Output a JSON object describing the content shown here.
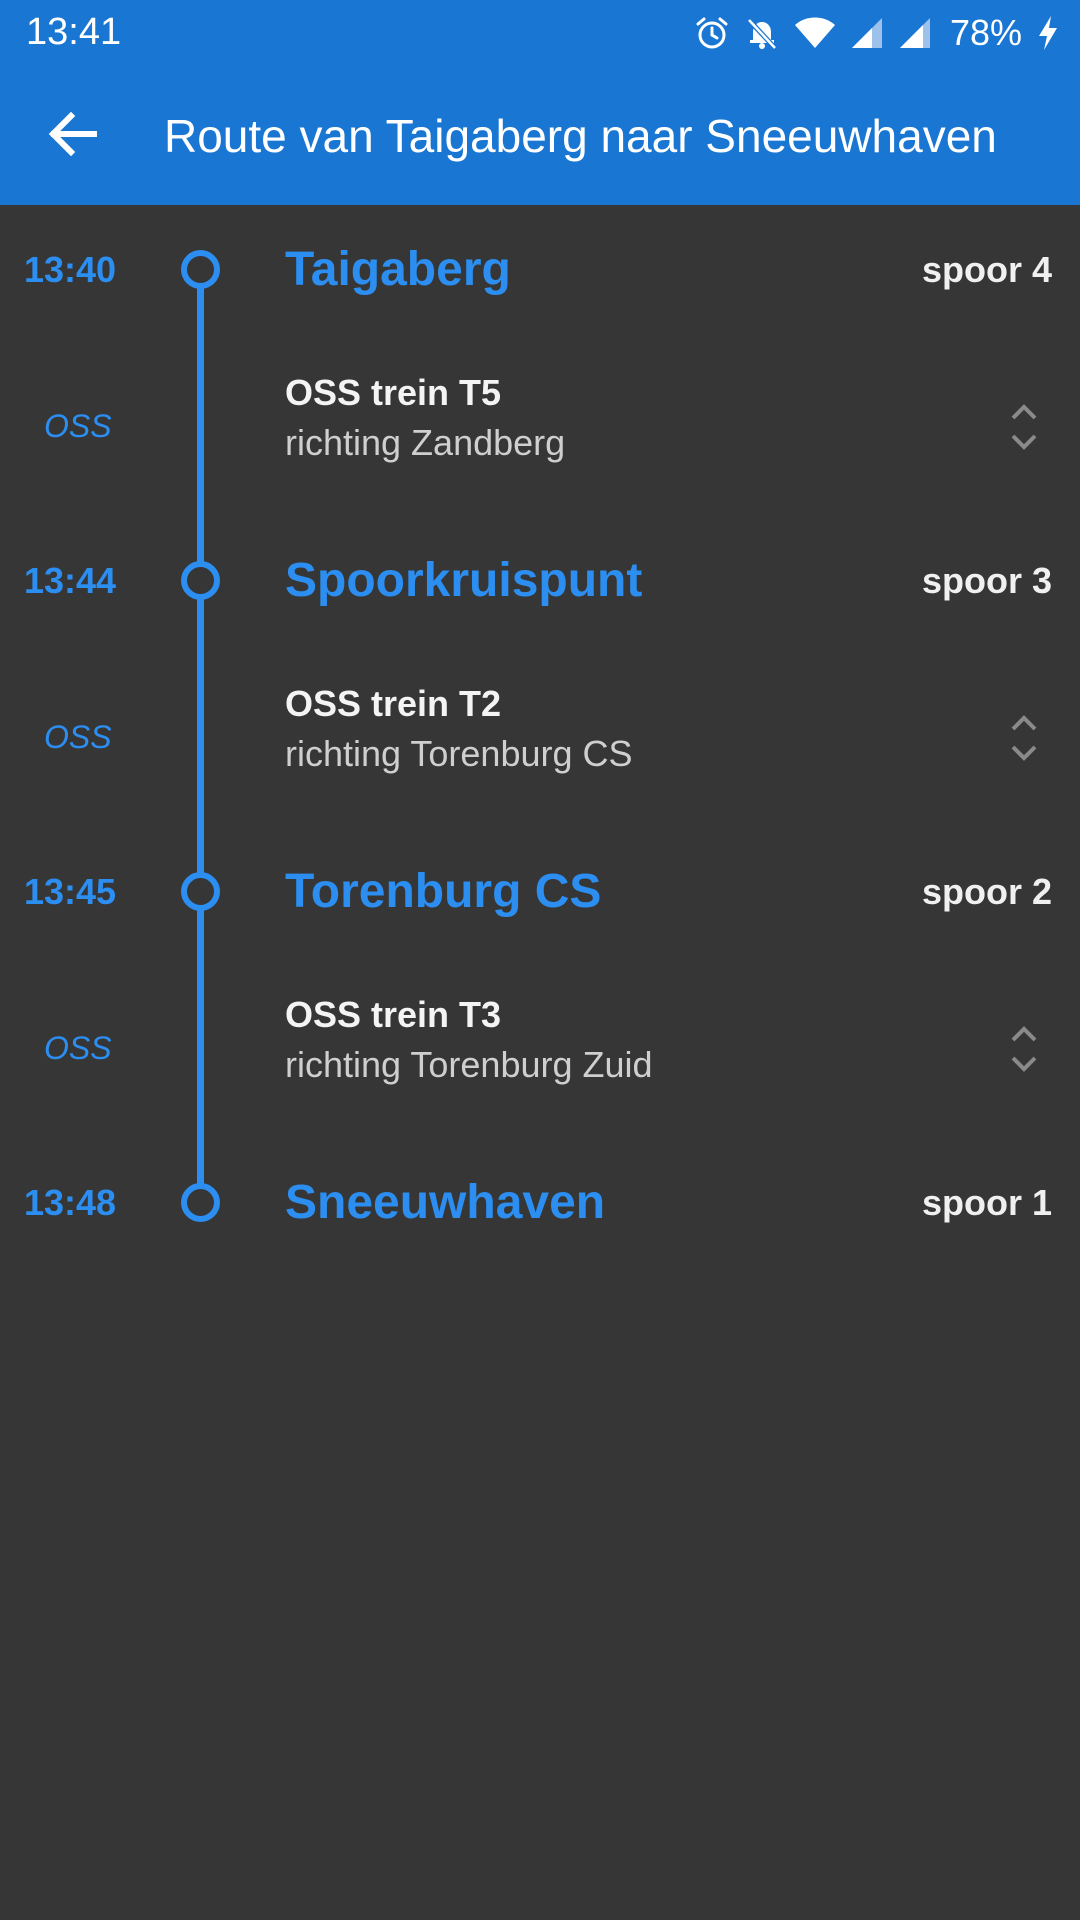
{
  "status_bar": {
    "time": "13:41",
    "battery": "78%",
    "icons": [
      "alarm-icon",
      "notifications-off-icon",
      "wifi-icon",
      "signal-icon",
      "signal-icon",
      "charging-icon"
    ]
  },
  "toolbar": {
    "title": "Route van Taigaberg naar Sneeuwhaven",
    "back_icon": "arrow-left-icon"
  },
  "colors": {
    "accent": "#2b8ef0",
    "appbar": "#1976d2",
    "background": "#363636"
  },
  "route": {
    "stops": [
      {
        "time": "13:40",
        "name": "Taigaberg",
        "platform": "spoor 4"
      },
      {
        "time": "13:44",
        "name": "Spoorkruispunt",
        "platform": "spoor 3"
      },
      {
        "time": "13:45",
        "name": "Torenburg CS",
        "platform": "spoor 2"
      },
      {
        "time": "13:48",
        "name": "Sneeuwhaven",
        "platform": "spoor 1"
      }
    ],
    "legs": [
      {
        "operator": "OSS",
        "title": "OSS trein T5",
        "direction": "richting Zandberg",
        "icon": "expand-icon"
      },
      {
        "operator": "OSS",
        "title": "OSS trein T2",
        "direction": "richting Torenburg CS",
        "icon": "expand-icon"
      },
      {
        "operator": "OSS",
        "title": "OSS trein T3",
        "direction": "richting Torenburg Zuid",
        "icon": "expand-icon"
      }
    ]
  }
}
